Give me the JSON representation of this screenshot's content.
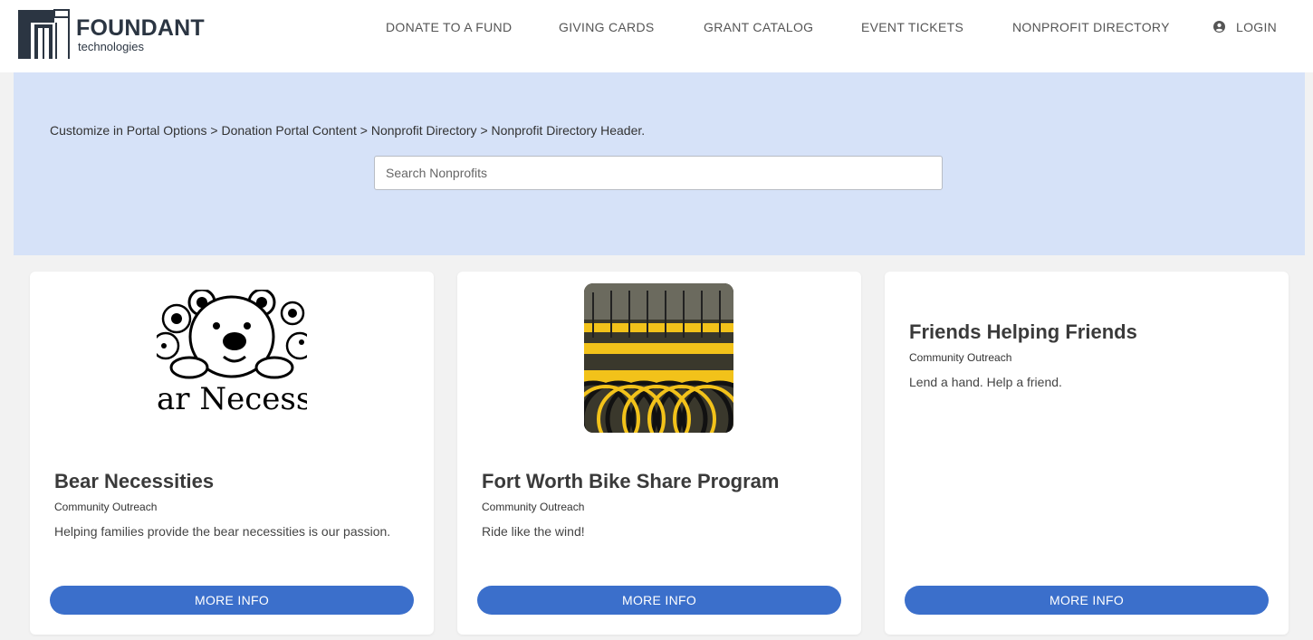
{
  "brand": {
    "name": "FOUNDANT",
    "tagline": "technologies"
  },
  "nav": {
    "donate": "DONATE TO A FUND",
    "giving_cards": "GIVING CARDS",
    "grant_catalog": "GRANT CATALOG",
    "event_tickets": "EVENT TICKETS",
    "nonprofit_directory": "NONPROFIT DIRECTORY",
    "login": "LOGIN"
  },
  "banner": {
    "breadcrumb": "Customize in Portal Options > Donation Portal Content > Nonprofit Directory > Nonprofit Directory Header.",
    "search_placeholder": "Search Nonprofits",
    "search_value": ""
  },
  "cards": [
    {
      "title": "Bear Necessities",
      "category": "Community Outreach",
      "description": "Helping families provide the bear necessities is our passion.",
      "button": "MORE INFO",
      "image_text": "ar Necessit"
    },
    {
      "title": "Fort Worth Bike Share Program",
      "category": "Community Outreach",
      "description": "Ride like the wind!",
      "button": "MORE INFO"
    },
    {
      "title": "Friends Helping Friends",
      "category": "Community Outreach",
      "description": "Lend a hand. Help a friend.",
      "button": "MORE INFO"
    }
  ],
  "colors": {
    "banner_bg": "#d6e2f8",
    "button_bg": "#3b6fcb",
    "logo_dark": "#2b3542"
  },
  "icons": {
    "login": "user-circle-icon"
  }
}
